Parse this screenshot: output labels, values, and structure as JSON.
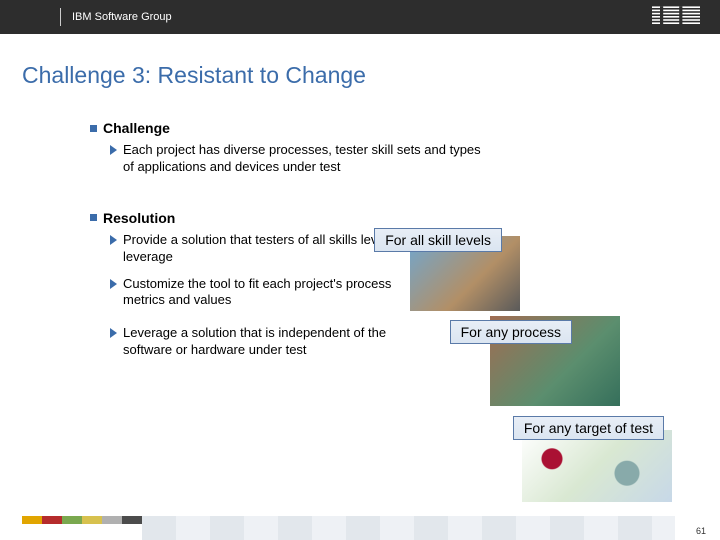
{
  "header": {
    "group_label": "IBM Software Group"
  },
  "title": "Challenge 3: Resistant to Change",
  "sections": {
    "challenge": {
      "heading": "Challenge",
      "items": [
        "Each project has diverse processes, tester skill sets and types of applications and devices under test"
      ]
    },
    "resolution": {
      "heading": "Resolution",
      "items": [
        "Provide a solution that testers of all skills levels can leverage",
        "Customize the tool to fit each project's process metrics and values",
        "Leverage a solution that is independent of the software or hardware under test"
      ]
    }
  },
  "callouts": {
    "c1": "For all skill levels",
    "c2": "For any process",
    "c3": "For any target of test"
  },
  "page_number": "61"
}
